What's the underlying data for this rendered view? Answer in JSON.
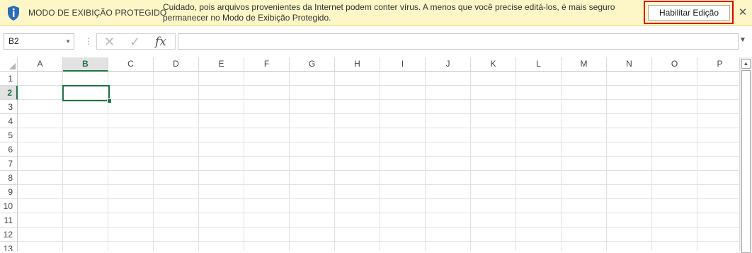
{
  "protected_view": {
    "title": "MODO DE EXIBIÇÃO PROTEGIDO",
    "message_line1": "Cuidado, pois arquivos provenientes da Internet podem conter vírus. A menos que você precise editá-los, é mais seguro",
    "message_line2": "permanecer no Modo de  Exibição Protegido.",
    "enable_button": "Habilitar Edição",
    "close_glyph": "✕",
    "info_icon": "shield-info-icon",
    "highlight_color": "#e00000"
  },
  "formula_bar": {
    "name_box": "B2",
    "name_box_arrow": "▼",
    "separator": "⋮",
    "cancel_glyph": "✕",
    "enter_glyph": "✓",
    "fx_label": "fx",
    "formula_value": "",
    "expand_glyph": "▼"
  },
  "grid": {
    "columns": [
      "A",
      "B",
      "C",
      "D",
      "E",
      "F",
      "G",
      "H",
      "I",
      "J",
      "K",
      "L",
      "M",
      "N",
      "O",
      "P"
    ],
    "rows": [
      "1",
      "2",
      "3",
      "4",
      "5",
      "6",
      "7",
      "8",
      "9",
      "10",
      "11",
      "12",
      "13"
    ],
    "selected_column": "B",
    "selected_row": "2",
    "accent_color": "#217346"
  },
  "scrollbar": {
    "up_glyph": "▲"
  }
}
